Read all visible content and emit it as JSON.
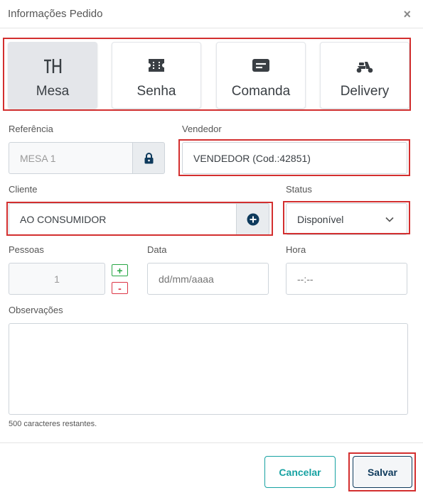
{
  "modal": {
    "title": "Informações Pedido",
    "close_symbol": "×"
  },
  "order_types": [
    {
      "label": "Mesa",
      "icon": "table-icon",
      "active": true
    },
    {
      "label": "Senha",
      "icon": "ticket-icon",
      "active": false
    },
    {
      "label": "Comanda",
      "icon": "card-icon",
      "active": false
    },
    {
      "label": "Delivery",
      "icon": "scooter-icon",
      "active": false
    }
  ],
  "referencia": {
    "label": "Referência",
    "value": "MESA 1",
    "icon": "lock-icon"
  },
  "vendedor": {
    "label": "Vendedor",
    "value": "VENDEDOR (Cod.:42851)"
  },
  "cliente": {
    "label": "Cliente",
    "value": "AO CONSUMIDOR",
    "icon": "plus-circle-icon"
  },
  "status": {
    "label": "Status",
    "value": "Disponível",
    "icon": "chevron-down-icon"
  },
  "pessoas": {
    "label": "Pessoas",
    "value": "1",
    "plus": "+",
    "minus": "-"
  },
  "data": {
    "label": "Data",
    "placeholder": "dd/mm/aaaa"
  },
  "hora": {
    "label": "Hora",
    "placeholder": "--:--"
  },
  "observacoes": {
    "label": "Observações",
    "remaining_text": "500 caracteres restantes."
  },
  "buttons": {
    "cancel": "Cancelar",
    "save": "Salvar"
  },
  "colors": {
    "highlight": "#d32f2f",
    "teal": "#17a2a2",
    "navy": "#0e3a5c",
    "plus": "#28a745",
    "minus": "#dc3545"
  }
}
